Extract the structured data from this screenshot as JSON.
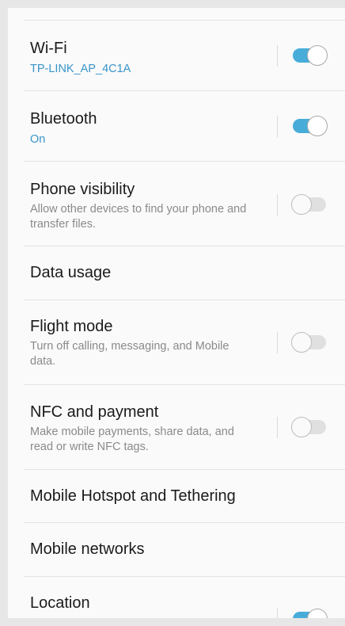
{
  "settings": {
    "items": [
      {
        "title": "Wi-Fi",
        "summary": "TP-LINK_AP_4C1A",
        "toggle": "on"
      },
      {
        "title": "Bluetooth",
        "summary": "On",
        "toggle": "on"
      },
      {
        "title": "Phone visibility",
        "summary": "Allow other devices to find your phone and transfer files.",
        "toggle": "off"
      },
      {
        "title": "Data usage"
      },
      {
        "title": "Flight mode",
        "summary": "Turn off calling, messaging, and Mobile data.",
        "toggle": "off"
      },
      {
        "title": "NFC and payment",
        "summary": "Make mobile payments, share data, and read or write NFC tags.",
        "toggle": "off"
      },
      {
        "title": "Mobile Hotspot and Tethering"
      },
      {
        "title": "Mobile networks"
      },
      {
        "title": "Location",
        "toggle": "on"
      }
    ]
  },
  "colors": {
    "accent": "#3a95c9",
    "toggle_on": "#48acd9",
    "toggle_off": "#e0e0e0"
  }
}
